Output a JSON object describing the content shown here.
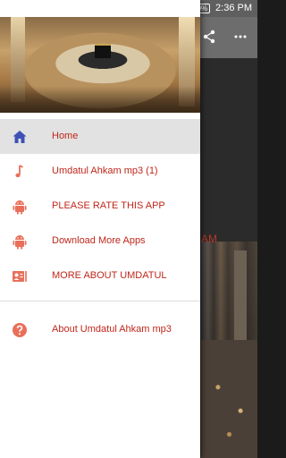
{
  "status_bar": {
    "battery": "100%",
    "time": "2:36 PM"
  },
  "background": {
    "title_fragment": "AM"
  },
  "drawer": {
    "items": [
      {
        "label": "Home",
        "icon": "home-icon"
      },
      {
        "label": "Umdatul Ahkam mp3 (1)",
        "icon": "music-note-icon"
      },
      {
        "label": "PLEASE RATE THIS APP",
        "icon": "android-icon"
      },
      {
        "label": "Download More Apps",
        "icon": "android-icon"
      },
      {
        "label": "MORE ABOUT UMDATUL",
        "icon": "contact-card-icon"
      }
    ],
    "footer_items": [
      {
        "label": "About Umdatul Ahkam mp3",
        "icon": "help-icon"
      }
    ]
  },
  "colors": {
    "accent_text": "#c0261a",
    "home_icon": "#3f51b5",
    "item_icon": "#e8705a",
    "active_row": "#e2e2e2"
  }
}
